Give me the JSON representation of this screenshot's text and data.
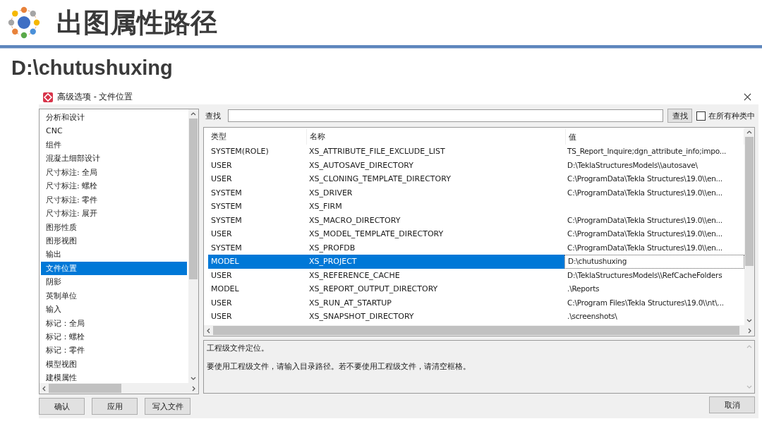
{
  "slide": {
    "title": "出图属性路径",
    "subtitle": "D:\\chutushuxing"
  },
  "window": {
    "title": "高级选项 - 文件位置"
  },
  "categories": [
    {
      "label": "分析和设计",
      "selected": false
    },
    {
      "label": "CNC",
      "selected": false
    },
    {
      "label": "组件",
      "selected": false
    },
    {
      "label": "混凝土细部设计",
      "selected": false
    },
    {
      "label": "尺寸标注: 全局",
      "selected": false
    },
    {
      "label": "尺寸标注: 螺栓",
      "selected": false
    },
    {
      "label": "尺寸标注: 零件",
      "selected": false
    },
    {
      "label": "尺寸标注: 展开",
      "selected": false
    },
    {
      "label": "图形性质",
      "selected": false
    },
    {
      "label": "图形视图",
      "selected": false
    },
    {
      "label": "输出",
      "selected": false
    },
    {
      "label": "文件位置",
      "selected": true
    },
    {
      "label": "阴影",
      "selected": false
    },
    {
      "label": "英制单位",
      "selected": false
    },
    {
      "label": "输入",
      "selected": false
    },
    {
      "label": "标记：全局",
      "selected": false
    },
    {
      "label": "标记：螺栓",
      "selected": false
    },
    {
      "label": "标记：零件",
      "selected": false
    },
    {
      "label": "模型视图",
      "selected": false
    },
    {
      "label": "建模属性",
      "selected": false
    }
  ],
  "search": {
    "label": "查找",
    "button": "查找",
    "checkbox": {
      "label": "在所有种类中",
      "checked": false
    }
  },
  "table": {
    "columns": [
      "类型",
      "名称",
      "值"
    ],
    "rows": [
      {
        "type": "SYSTEM(ROLE)",
        "name": "XS_ATTRIBUTE_FILE_EXCLUDE_LIST",
        "value": "TS_Report_Inquire;dgn_attribute_info;impo...",
        "selected": false
      },
      {
        "type": "USER",
        "name": "XS_AUTOSAVE_DIRECTORY",
        "value": "D:\\TeklaStructuresModels\\\\autosave\\",
        "selected": false
      },
      {
        "type": "USER",
        "name": "XS_CLONING_TEMPLATE_DIRECTORY",
        "value": "C:\\ProgramData\\Tekla Structures\\19.0\\\\en...",
        "selected": false
      },
      {
        "type": "SYSTEM",
        "name": "XS_DRIVER",
        "value": "C:\\ProgramData\\Tekla Structures\\19.0\\\\en...",
        "selected": false
      },
      {
        "type": "SYSTEM",
        "name": "XS_FIRM",
        "selected": false
      },
      {
        "type": "SYSTEM",
        "name": "XS_MACRO_DIRECTORY",
        "value": "C:\\ProgramData\\Tekla Structures\\19.0\\\\en...",
        "selected": false
      },
      {
        "type": "USER",
        "name": "XS_MODEL_TEMPLATE_DIRECTORY",
        "value": "C:\\ProgramData\\Tekla Structures\\19.0\\\\en...",
        "selected": false
      },
      {
        "type": "SYSTEM",
        "name": "XS_PROFDB",
        "value": "C:\\ProgramData\\Tekla Structures\\19.0\\\\en...",
        "selected": false
      },
      {
        "type": "MODEL",
        "name": "XS_PROJECT",
        "value": "D:\\chutushuxing",
        "selected": true
      },
      {
        "type": "USER",
        "name": "XS_REFERENCE_CACHE",
        "value": "D:\\TeklaStructuresModels\\\\RefCacheFolders",
        "selected": false
      },
      {
        "type": "MODEL",
        "name": "XS_REPORT_OUTPUT_DIRECTORY",
        "value": ".\\Reports",
        "selected": false
      },
      {
        "type": "USER",
        "name": "XS_RUN_AT_STARTUP",
        "value": "C:\\Program Files\\Tekla Structures\\19.0\\\\nt\\...",
        "selected": false
      },
      {
        "type": "USER",
        "name": "XS_SNAPSHOT_DIRECTORY",
        "value": ".\\screenshots\\",
        "selected": false
      }
    ]
  },
  "description": [
    "工程级文件定位。",
    "要使用工程级文件，请输入目录路径。若不要使用工程级文件，请清空框格。"
  ],
  "footer": {
    "left_buttons": [
      "确认",
      "应用",
      "写入文件"
    ],
    "right_buttons": [
      "取消"
    ]
  }
}
